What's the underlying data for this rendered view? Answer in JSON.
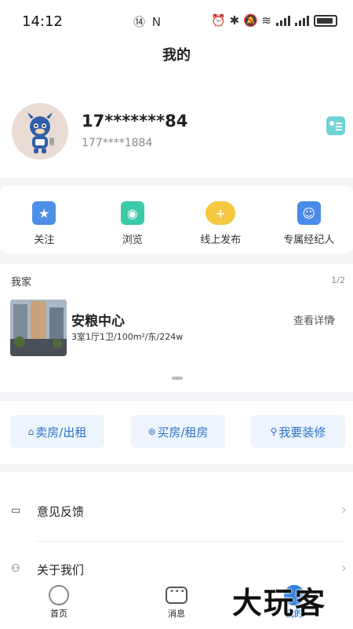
{
  "status_bar": {
    "time": "14:12",
    "left_icons": "⑭ N",
    "right_icons": "⏰ ✱ 🔕 ≋"
  },
  "header": {
    "title": "我的"
  },
  "profile": {
    "name": "17*******84",
    "phone": "177****1884",
    "avatar_icon": "mascot-avatar",
    "card_icon": "id-card-icon"
  },
  "quick_actions": [
    {
      "label": "关注",
      "icon": "star-icon",
      "color": "#4d8fe6"
    },
    {
      "label": "浏览",
      "icon": "search-icon",
      "color": "#3cc9a8"
    },
    {
      "label": "线上发布",
      "icon": "cloud-plus-icon",
      "color": "#f5c842"
    },
    {
      "label": "专属经纪人",
      "icon": "agent-icon",
      "color": "#4a8bea"
    }
  ],
  "my_home": {
    "title": "我家",
    "page": "1/2",
    "name": "安粮中心",
    "desc": "3室1厅1卫/100m²/东/224w",
    "detail_link": "查看详情"
  },
  "service_buttons": [
    {
      "label": "卖房/出租",
      "icon": "⌂"
    },
    {
      "label": "买房/租房",
      "icon": "⊛"
    },
    {
      "label": "我要装修",
      "icon": "⚲"
    }
  ],
  "menu": [
    {
      "label": "意见反馈",
      "icon": "feedback-icon"
    },
    {
      "label": "关于我们",
      "icon": "users-icon"
    }
  ],
  "tabbar": [
    {
      "label": "首页",
      "icon": "home-tab-icon"
    },
    {
      "label": "消息",
      "icon": "chat-icon"
    },
    {
      "label": "我的",
      "icon": "me-tab-icon"
    }
  ],
  "watermark": "大玩客",
  "colors": {
    "accent": "#2e7fdc",
    "action_bg": "#eef4fb",
    "action_text": "#2b72c9"
  }
}
